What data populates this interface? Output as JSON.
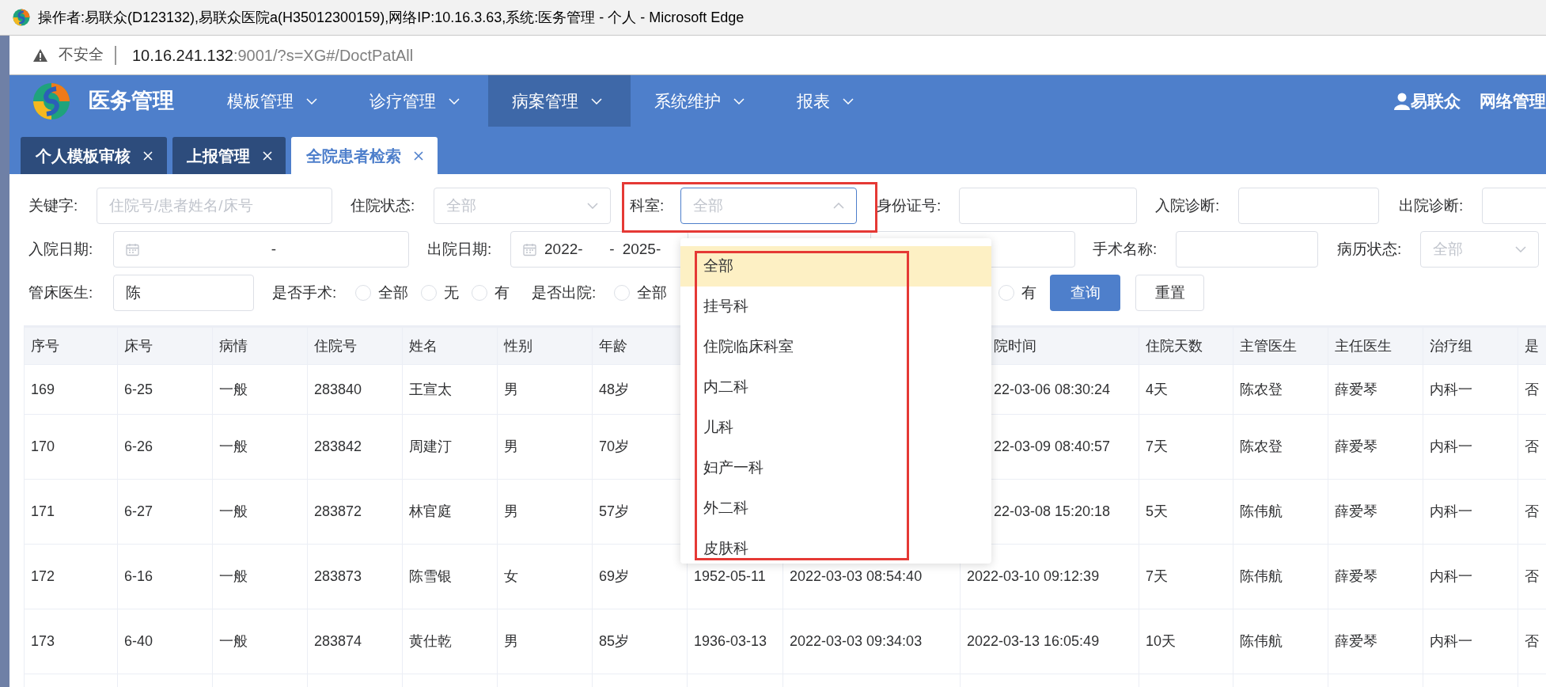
{
  "browser": {
    "title": "操作者:易联众(D123132),易联众医院a(H35012300159),网络IP:10.16.3.63,系统:医务管理 - 个人 - Microsoft Edge",
    "security_label": "不安全",
    "url_host": "10.16.241.132",
    "url_path": ":9001/?s=XG#/DoctPatAll"
  },
  "app": {
    "name": "医务管理",
    "menu": [
      {
        "label": "模板管理",
        "selected": false
      },
      {
        "label": "诊疗管理",
        "selected": false
      },
      {
        "label": "病案管理",
        "selected": true
      },
      {
        "label": "系统维护",
        "selected": false
      },
      {
        "label": "报表",
        "selected": false
      }
    ],
    "user": "易联众",
    "user_menu": "网络管理"
  },
  "tabs": [
    {
      "label": "个人模板审核",
      "selected": false
    },
    {
      "label": "上报管理",
      "selected": false
    },
    {
      "label": "全院患者检索",
      "selected": true
    }
  ],
  "filter_rows": [
    [
      {
        "kind": "text",
        "label": "关键字:",
        "placeholder": "住院号/患者姓名/床号"
      },
      {
        "kind": "select",
        "label": "住院状态:",
        "placeholder": "全部",
        "expanded": false
      },
      {
        "kind": "select",
        "label": "科室:",
        "placeholder": "全部",
        "expanded": true,
        "annotated": true,
        "options": [
          {
            "label": "全部",
            "selected": true
          },
          {
            "label": "挂号科",
            "selected": false
          },
          {
            "label": "住院临床科室",
            "selected": false
          },
          {
            "label": "内二科",
            "selected": false
          },
          {
            "label": "儿科",
            "selected": false
          },
          {
            "label": "妇产一科",
            "selected": false
          },
          {
            "label": "外二科",
            "selected": false
          },
          {
            "label": "皮肤科",
            "selected": false
          }
        ]
      },
      {
        "kind": "text",
        "label": "身份证号:"
      },
      {
        "kind": "text",
        "label": "入院诊断:"
      },
      {
        "kind": "text",
        "label": "出院诊断:"
      }
    ],
    [
      {
        "kind": "date_range",
        "label": "入院日期:",
        "separator": "-"
      },
      {
        "kind": "date_range",
        "label": "出院日期:",
        "start": "2022-",
        "end": "2025-",
        "separator": "-"
      },
      {
        "kind": "text"
      },
      {
        "kind": "text",
        "label": "手术名称:"
      },
      {
        "kind": "select",
        "label": "病历状态:",
        "placeholder": "全部",
        "expanded": false
      }
    ],
    [
      {
        "kind": "text",
        "label": "管床医生:",
        "value": "陈"
      },
      {
        "kind": "radio",
        "label": "是否手术:",
        "options": [
          {
            "label": "全部",
            "selected": false
          },
          {
            "label": "无",
            "selected": false
          },
          {
            "label": "有",
            "selected": false
          }
        ]
      },
      {
        "kind": "radio",
        "label": "是否出院:",
        "options": [
          {
            "label": "全部",
            "selected": false
          },
          {
            "label": "有",
            "selected": false
          }
        ]
      },
      {
        "kind": "button",
        "label": "查询",
        "primary": true
      },
      {
        "kind": "button",
        "label": "重置",
        "primary": false
      }
    ]
  ],
  "table": {
    "columns": [
      "序号",
      "床号",
      "病情",
      "住院号",
      "姓名",
      "性别",
      "年龄",
      null,
      null,
      "院时间",
      "住院天数",
      "主管医生",
      "主任医生",
      "治疗组",
      "是"
    ],
    "rows": [
      [
        "169",
        "6-25",
        "一般",
        "283840",
        "王宣太",
        "男",
        "48岁",
        null,
        null,
        "22-03-06 08:30:24",
        "4天",
        "陈农登",
        "薛爱琴",
        "内科一",
        "否"
      ],
      [
        "170",
        "6-26",
        "一般",
        "283842",
        "周建汀",
        "男",
        "70岁",
        null,
        null,
        "22-03-09 08:40:57",
        "7天",
        "陈农登",
        "薛爱琴",
        "内科一",
        "否"
      ],
      [
        "171",
        "6-27",
        "一般",
        "283872",
        "林官庭",
        "男",
        "57岁",
        null,
        null,
        "22-03-08 15:20:18",
        "5天",
        "陈伟航",
        "薛爱琴",
        "内科一",
        "否"
      ],
      [
        "172",
        "6-16",
        "一般",
        "283873",
        "陈雪银",
        "女",
        "69岁",
        "1952-05-11",
        "2022-03-03 08:54:40",
        "2022-03-10 09:12:39",
        "7天",
        "陈伟航",
        "薛爱琴",
        "内科一",
        "否"
      ],
      [
        "173",
        "6-40",
        "一般",
        "283874",
        "黄仕乾",
        "男",
        "85岁",
        "1936-03-13",
        "2022-03-03 09:34:03",
        "2022-03-13 16:05:49",
        "10天",
        "陈伟航",
        "薛爱琴",
        "内科一",
        "否"
      ]
    ]
  }
}
